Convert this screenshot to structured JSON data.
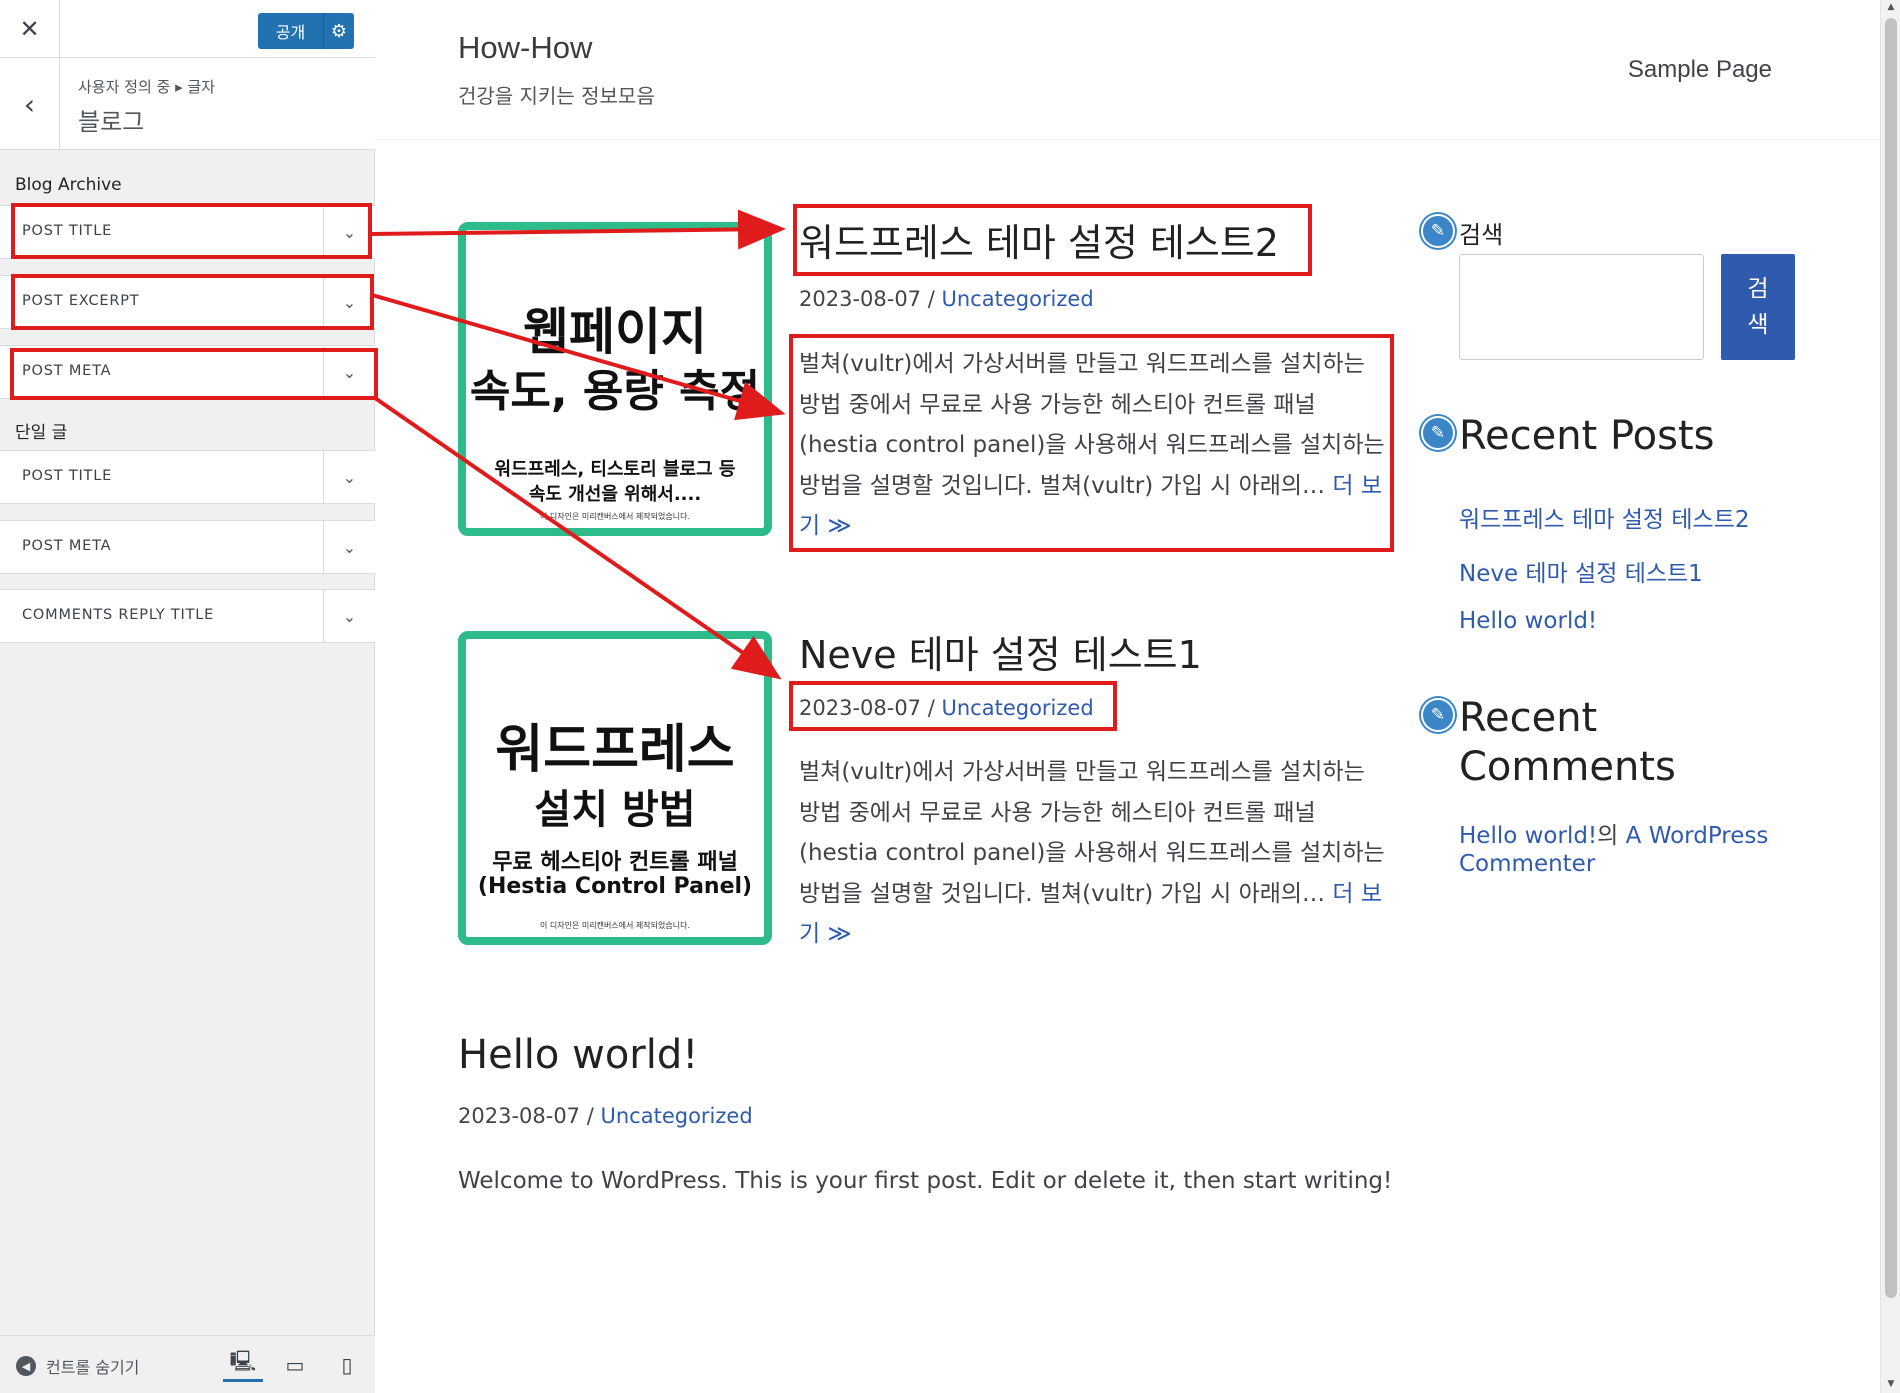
{
  "customizer": {
    "close_label": "✕",
    "publish_label": "공개",
    "settings_icon": "gear-icon",
    "back_icon": "chevron-left-icon",
    "breadcrumb": "사용자 정의 중 ▸ 글자",
    "section_title": "블로그",
    "blog_archive_label": "Blog Archive",
    "archive_controls": [
      "POST TITLE",
      "POST EXCERPT",
      "POST META"
    ],
    "single_label": "단일 글",
    "single_controls": [
      "POST TITLE",
      "POST META",
      "COMMENTS REPLY TITLE"
    ],
    "hide_controls_label": "컨트롤 숨기기",
    "devices": [
      "desktop",
      "tablet",
      "mobile"
    ]
  },
  "site": {
    "title": "How-How",
    "tagline": "건강을 지키는 정보모음",
    "nav": [
      "Sample Page"
    ]
  },
  "posts": [
    {
      "title": "워드프레스 테마 설정 테스트2",
      "date": "2023-08-07",
      "separator": "/",
      "category": "Uncategorized",
      "excerpt": "벌쳐(vultr)에서 가상서버를 만들고 워드프레스를 설치하는 방법 중에서 무료로 사용 가능한 헤스티아 컨트롤 패널(hestia control panel)을 사용해서 워드프레스를 설치하는 방법을 설명할 것입니다. 벌쳐(vultr) 가입 시 아래의…",
      "more": "더 보기 ≫",
      "thumb_lines": [
        "웹페이지",
        "속도, 용량 측정",
        "워드프레스, 티스토리 블로그 등",
        "속도 개선을 위해서...."
      ],
      "thumb_credit": "이 디자인은 미리캔버스에서 제작되었습니다."
    },
    {
      "title": "Neve 테마 설정 테스트1",
      "date": "2023-08-07",
      "separator": "/",
      "category": "Uncategorized",
      "excerpt": "벌쳐(vultr)에서 가상서버를 만들고 워드프레스를 설치하는 방법 중에서 무료로 사용 가능한 헤스티아 컨트롤 패널(hestia control panel)을 사용해서 워드프레스를 설치하는 방법을 설명할 것입니다. 벌쳐(vultr) 가입 시 아래의…",
      "more": "더 보기 ≫",
      "thumb_lines": [
        "워드프레스",
        "설치 방법",
        "무료 헤스티아 컨트롤 패널",
        "(Hestia Control Panel)"
      ],
      "thumb_credit": "이 디자인은 미리캔버스에서 제작되었습니다."
    },
    {
      "title": "Hello world!",
      "date": "2023-08-07",
      "separator": "/",
      "category": "Uncategorized",
      "excerpt": "Welcome to WordPress. This is your first post. Edit or delete it, then start writing!"
    }
  ],
  "widgets": {
    "search_title": "검색",
    "search_button": "검색",
    "search_placeholder": "",
    "recent_posts_title": "Recent Posts",
    "recent_posts": [
      "워드프레스 테마 설정 테스트2",
      "Neve 테마 설정 테스트1",
      "Hello world!"
    ],
    "recent_comments_title": "Recent Comments",
    "comment_post": "Hello world!",
    "comment_connector": "의",
    "comment_author": "A WordPress Commenter",
    "widget_icon": "pencil-icon"
  },
  "annotations": {
    "highlight_color": "#e01b1b"
  }
}
